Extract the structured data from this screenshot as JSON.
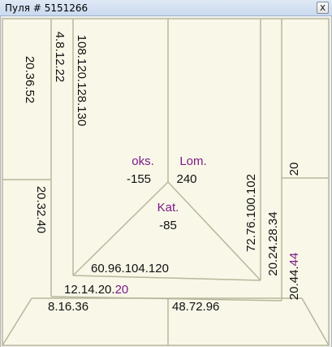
{
  "window": {
    "title": "Пуля # 5151266",
    "close_label": "x"
  },
  "colors": {
    "background": "#f8f7e8",
    "line": "#b8b79c",
    "text": "#111111",
    "accent": "#7b1a86"
  },
  "board": {
    "left_outer": "20.36.52",
    "left_mid": "4.8.12.22",
    "left_inner": "108.120.128.130",
    "left_lower": "20.32.40",
    "player_top_left_name": "oks.",
    "player_top_left_score": "-155",
    "player_top_right_name": "Lom.",
    "player_top_right_score": "240",
    "player_bottom_name": "Kat.",
    "player_bottom_score": "-85",
    "bottom_inner": "60.96.104.120",
    "bottom_mid_plain": "12.14.20.",
    "bottom_mid_highlight": "20",
    "bottom_outer_left": "8.16.36",
    "bottom_outer_right": "48.72.96",
    "right_inner": "72.76.100.102",
    "right_mid": "20.24.28.34",
    "right_outer_plain": "20.44.",
    "right_outer_highlight": "44",
    "right_upper": "20"
  }
}
